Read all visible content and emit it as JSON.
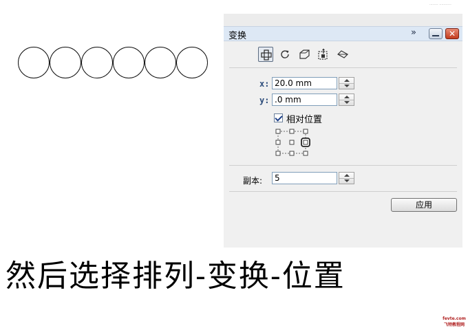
{
  "panel": {
    "title": "变换",
    "collapse_glyph": "»",
    "close_glyph": "✕",
    "toolbar_tools": [
      "position-icon",
      "rotate-icon",
      "scale-mirror-icon",
      "size-icon",
      "skew-icon"
    ],
    "active_tool": "position-icon",
    "x_label": "x:",
    "x_value": "20.0 mm",
    "y_label": "y:",
    "y_value": ".0 mm",
    "relative_position_label": "相对位置",
    "relative_position_checked": true,
    "anchor_selected": "right-middle",
    "copies_label": "副本:",
    "copies_value": "5",
    "apply_label": "应用"
  },
  "canvas": {
    "circle_count": 6
  },
  "caption": "然后选择排列-变换-位置",
  "watermark": {
    "top": "........ ...........",
    "bottom_line1": "fevte.com",
    "bottom_line2": "飞特教程网"
  },
  "colors": {
    "titlebar": "#dde8f5",
    "panel_bg": "#f0f0f0",
    "close_button": "#c33b1c",
    "label_blue": "#2b4b7a"
  }
}
